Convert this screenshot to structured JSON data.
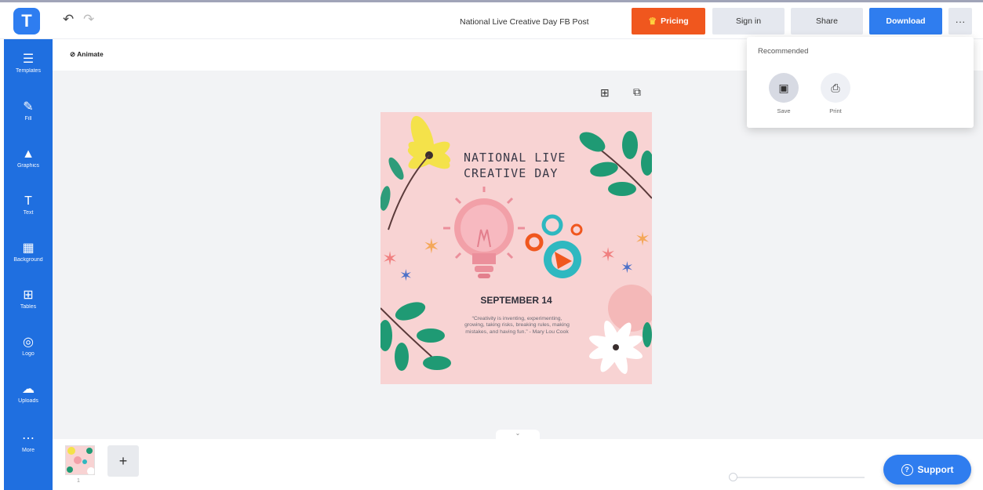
{
  "app": {
    "logo_letter": "T"
  },
  "header": {
    "title": "National Live Creative Day FB Post",
    "pricing_label": "Pricing",
    "signin_label": "Sign in",
    "share_label": "Share",
    "download_label": "Download",
    "more_label": "···"
  },
  "sidebar": {
    "items": [
      {
        "label": "Templates",
        "icon": "templates-icon"
      },
      {
        "label": "Fill",
        "icon": "brush-icon"
      },
      {
        "label": "Graphics",
        "icon": "shapes-icon"
      },
      {
        "label": "Text",
        "icon": "text-icon"
      },
      {
        "label": "Background",
        "icon": "background-icon"
      },
      {
        "label": "Tables",
        "icon": "table-icon"
      },
      {
        "label": "Logo",
        "icon": "logo-icon"
      },
      {
        "label": "Uploads",
        "icon": "upload-icon"
      },
      {
        "label": "More",
        "icon": "more-icon"
      }
    ]
  },
  "toolbar": {
    "animate_label": "Animate"
  },
  "design": {
    "title_line1": "NATIONAL LIVE",
    "title_line2": "CREATIVE DAY",
    "date": "SEPTEMBER 14",
    "quote": "“Creativity is inventing, experimenting, growing, taking risks, breaking rules, making mistakes, and having fun.” - Mary Lou Cook"
  },
  "pages": {
    "thumb_number": "1",
    "add_label": "+"
  },
  "support": {
    "label": "Support"
  },
  "download_menu": {
    "heading": "Recommended",
    "options": [
      {
        "label": "Save",
        "icon": "save-icon"
      },
      {
        "label": "Print",
        "icon": "print-icon"
      }
    ]
  },
  "colors": {
    "brand_blue": "#2f7def",
    "sidebar_blue": "#1f6fe0",
    "pricing_orange": "#f0571e",
    "poster_pink": "#f8d3d3"
  }
}
